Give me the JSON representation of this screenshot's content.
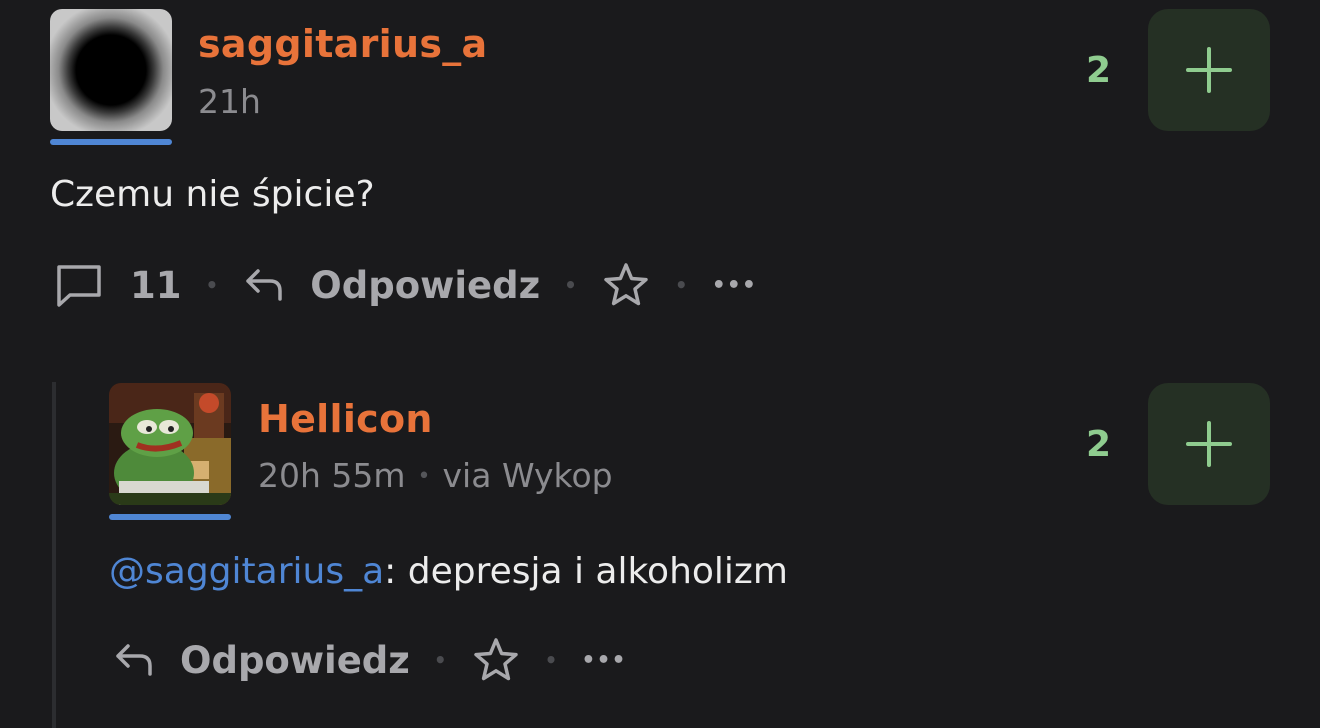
{
  "post": {
    "author": "saggitarius_a",
    "time": "21h",
    "text": "Czemu nie śpicie?",
    "votes": "2",
    "comments_count": "11",
    "reply_label": "Odpowiedz",
    "sep": "•",
    "more": "•••"
  },
  "reply": {
    "author": "Hellicon",
    "time": "20h 55m",
    "sep": "•",
    "source": "via Wykop",
    "mention": "@saggitarius_a",
    "text": ": depresja i alkoholizm",
    "votes": "2",
    "reply_label": "Odpowiedz",
    "more": "•••"
  },
  "colors": {
    "background": "#1a1a1c",
    "username": "#e8733a",
    "mention": "#4f86d4",
    "vote_green": "#8fcc8f",
    "plus_bg": "#253024"
  }
}
